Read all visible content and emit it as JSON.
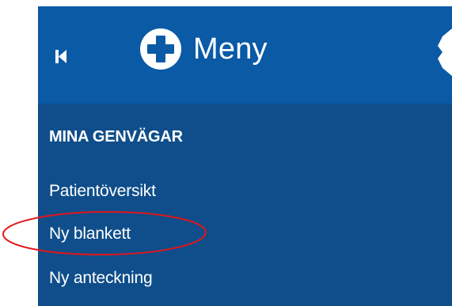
{
  "header": {
    "menu_label": "Meny",
    "icons": {
      "collapse": "collapse-left-icon",
      "menu": "plus-circle-icon",
      "edge": "partial-icon"
    }
  },
  "shortcuts": {
    "title": "MINA GENVÄGAR",
    "items": [
      {
        "label": "Patientöversikt"
      },
      {
        "label": "Ny blankett",
        "highlighted": true
      },
      {
        "label": "Ny anteckning"
      }
    ]
  },
  "colors": {
    "header_bg": "#0a5aa6",
    "panel_bg": "#0f4e8a",
    "text": "#ffffff",
    "highlight": "#e3151a"
  }
}
